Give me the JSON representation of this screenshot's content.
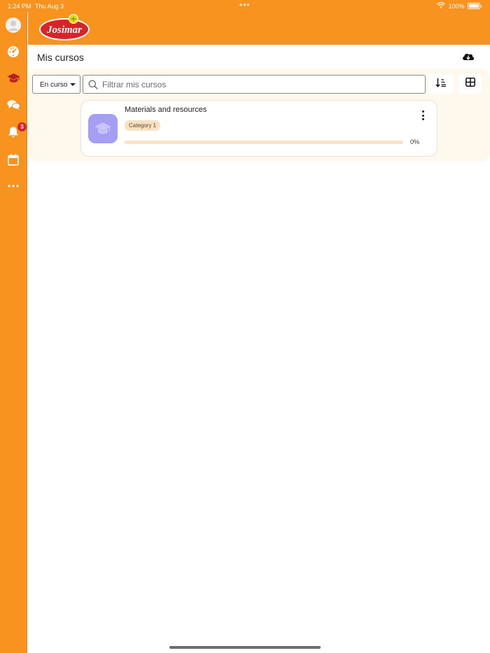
{
  "status_bar": {
    "time": "1:24 PM",
    "date": "Thu Aug 3",
    "dots": "•••",
    "battery": "100%"
  },
  "sidebar": {
    "items": [
      {
        "icon": "avatar-icon"
      },
      {
        "icon": "dashboard-icon"
      },
      {
        "icon": "graduation-cap-icon",
        "active": true
      },
      {
        "icon": "chat-icon"
      },
      {
        "icon": "bell-icon",
        "badge": "3"
      },
      {
        "icon": "calendar-icon"
      },
      {
        "icon": "more-icon"
      }
    ]
  },
  "header": {
    "logo_text": "Josimar"
  },
  "main": {
    "title": "Mis cursos",
    "filter": {
      "selected": "En curso"
    },
    "search": {
      "placeholder": "Filtrar mis cursos",
      "value": ""
    },
    "courses": [
      {
        "title": "Materials and resources",
        "category": "Category 1",
        "progress_text": "0%",
        "progress": 0
      }
    ]
  },
  "colors": {
    "brand": "#f7931e",
    "panel": "#fff8ec",
    "course_image": "#a49ef5",
    "badge": "#d9252a"
  }
}
